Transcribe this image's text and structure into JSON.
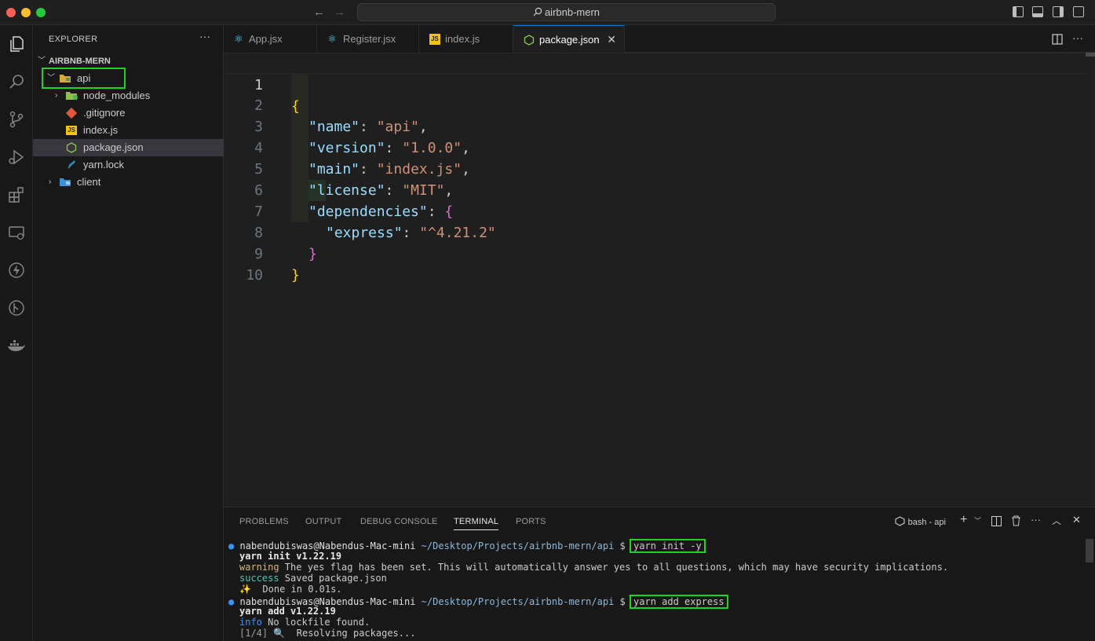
{
  "window": {
    "title": "airbnb-mern"
  },
  "explorer": {
    "header": "EXPLORER",
    "more": "···",
    "project": "AIRBNB-MERN",
    "items": [
      {
        "label": "api",
        "kind": "folder-open"
      },
      {
        "label": "node_modules",
        "kind": "folder"
      },
      {
        "label": ".gitignore",
        "kind": "git"
      },
      {
        "label": "index.js",
        "kind": "js"
      },
      {
        "label": "package.json",
        "kind": "json"
      },
      {
        "label": "yarn.lock",
        "kind": "yarn"
      },
      {
        "label": "client",
        "kind": "folder"
      }
    ]
  },
  "tabs": [
    {
      "label": "App.jsx",
      "icon": "react-icon"
    },
    {
      "label": "Register.jsx",
      "icon": "react-icon"
    },
    {
      "label": "index.js",
      "icon": "js-icon"
    },
    {
      "label": "package.json",
      "icon": "nodejs-icon",
      "close": "✕"
    }
  ],
  "editor": {
    "line_numbers": [
      "1",
      "2",
      "3",
      "4",
      "5",
      "6",
      "7",
      "8",
      "9",
      "10"
    ],
    "tokens": {
      "open_brace": "{",
      "name_key": "\"name\"",
      "name_val": "\"api\"",
      "version_key": "\"version\"",
      "version_val": "\"1.0.0\"",
      "main_key": "\"main\"",
      "main_val": "\"index.js\"",
      "license_key": "\"license\"",
      "license_val": "\"MIT\"",
      "deps_key": "\"dependencies\"",
      "deps_open": "{",
      "express_key": "\"express\"",
      "express_val": "\"^4.21.2\"",
      "deps_close": "}",
      "close_brace": "}",
      "colon": ": ",
      "comma": ","
    }
  },
  "panel": {
    "tabs": [
      "PROBLEMS",
      "OUTPUT",
      "DEBUG CONSOLE",
      "TERMINAL",
      "PORTS"
    ],
    "active_tab": "TERMINAL",
    "shell": "bash - api",
    "terminal": {
      "prompt_user": "nabendubiswas@Nabendus-Mac-mini",
      "prompt_path": "~/Desktop/Projects/airbnb-mern/api",
      "prompt_symbol": "$",
      "cmd1": "yarn init -y",
      "out1_bold": "yarn init v1.22.19",
      "out1_warn_label": "warning",
      "out1_warn_text": " The yes flag has been set. This will automatically answer yes to all questions, which may have security implications.",
      "out1_succ_label": "success",
      "out1_succ_text": " Saved package.json",
      "out1_done": "✨  Done in 0.01s.",
      "cmd2": "yarn add express",
      "out2_bold": "yarn add v1.22.19",
      "out2_info_label": "info",
      "out2_info_text": " No lockfile found.",
      "out2_step": "[1/4]",
      "out2_step_text": " 🔍  Resolving packages..."
    }
  },
  "colors": {
    "highlight": "#1ed41e",
    "accent": "#0078d4"
  }
}
